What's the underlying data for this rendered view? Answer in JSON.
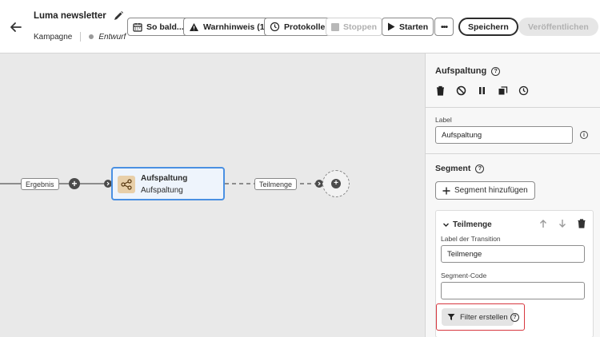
{
  "header": {
    "title": "Luma newsletter",
    "type_label": "Kampagne",
    "status": "Entwurf",
    "buttons": {
      "schedule": "So bald...",
      "warning": "Warnhinweis (1)",
      "logs": "Protokolle",
      "stop": "Stoppen",
      "start": "Starten",
      "more": "•••",
      "save": "Speichern",
      "publish": "Veröffentlichen"
    }
  },
  "canvas": {
    "edge_label_left": "Ergebnis",
    "node": {
      "title": "Aufspaltung",
      "subtitle": "Aufspaltung"
    },
    "edge_label_right": "Teilmenge"
  },
  "panel": {
    "title": "Aufspaltung",
    "label_field": {
      "label": "Label",
      "value": "Aufspaltung"
    },
    "segment_title": "Segment",
    "add_segment": "Segment hinzufügen",
    "segment_card": {
      "title": "Teilmenge",
      "transition_label": "Label der Transition",
      "transition_value": "Teilmenge",
      "code_label": "Segment-Code",
      "code_value": "",
      "filter_button": "Filter erstellen"
    }
  },
  "colors": {
    "node_border": "#4a90e2",
    "highlight_border": "#d7373f",
    "node_icon_bg": "#e8cfa9"
  }
}
